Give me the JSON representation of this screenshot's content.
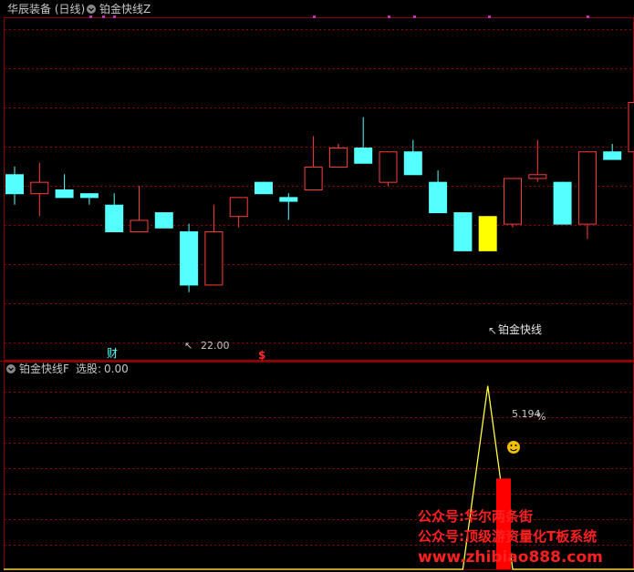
{
  "upper_panel": {
    "title": "华辰装备 (日线)",
    "indicator": "铂金快线Z",
    "low_annotation": "22.00",
    "signal_label": "铂金快线",
    "marker_cai": "财",
    "marker_dollar": "$"
  },
  "lower_panel": {
    "indicator": "铂金快线F",
    "select_label": "选股:",
    "select_value": "0.00",
    "percent_label": "5.194",
    "percent_sign": "%"
  },
  "watermark": {
    "line1": "公众号:华尔两条街",
    "line2": "公众号:顶级游资量化T板系统",
    "line3": "www.zhibiao888.com"
  },
  "colors": {
    "up": "#ff3c3c",
    "down": "#54ffff",
    "signal": "#ffff00",
    "grid": "#8b0000",
    "purple": "#c030c0"
  },
  "icons": {
    "dropdown": "chevron-down-circle-icon",
    "arrow": "arrow-up-left-icon",
    "smiley": "smiley-icon"
  },
  "chart_data": {
    "type": "candlestick",
    "price_range": [
      20.5,
      29.5
    ],
    "candles": [
      {
        "open": 25.4,
        "close": 24.9,
        "high": 25.6,
        "low": 24.6
      },
      {
        "open": 24.9,
        "close": 25.2,
        "high": 25.7,
        "low": 24.3
      },
      {
        "open": 25.0,
        "close": 24.8,
        "high": 25.4,
        "low": 24.8
      },
      {
        "open": 24.9,
        "close": 24.8,
        "high": 24.9,
        "low": 24.6
      },
      {
        "open": 24.6,
        "close": 23.9,
        "high": 24.9,
        "low": 23.9
      },
      {
        "open": 23.9,
        "close": 24.2,
        "high": 25.1,
        "low": 23.9
      },
      {
        "open": 24.4,
        "close": 24.0,
        "high": 24.4,
        "low": 24.0
      },
      {
        "open": 23.9,
        "close": 22.5,
        "high": 24.1,
        "low": 22.3
      },
      {
        "open": 22.5,
        "close": 23.9,
        "high": 24.6,
        "low": 22.5
      },
      {
        "open": 24.3,
        "close": 24.8,
        "high": 24.8,
        "low": 24.0
      },
      {
        "open": 25.2,
        "close": 24.9,
        "high": 25.2,
        "low": 24.9
      },
      {
        "open": 24.8,
        "close": 24.7,
        "high": 24.9,
        "low": 24.2
      },
      {
        "open": 25.0,
        "close": 25.6,
        "high": 26.4,
        "low": 25.0
      },
      {
        "open": 25.6,
        "close": 26.1,
        "high": 26.2,
        "low": 25.6
      },
      {
        "open": 26.1,
        "close": 25.7,
        "high": 26.9,
        "low": 25.7
      },
      {
        "open": 25.2,
        "close": 26.0,
        "high": 26.0,
        "low": 25.1
      },
      {
        "open": 26.0,
        "close": 25.4,
        "high": 26.3,
        "low": 25.4
      },
      {
        "open": 25.2,
        "close": 24.4,
        "high": 25.5,
        "low": 24.4
      },
      {
        "open": 24.4,
        "close": 23.4,
        "high": 24.4,
        "low": 23.4
      },
      {
        "open": 23.4,
        "close": 24.3,
        "high": 24.3,
        "low": 23.4
      },
      {
        "open": 24.1,
        "close": 25.3,
        "high": 25.3,
        "low": 24.0
      },
      {
        "open": 25.3,
        "close": 25.4,
        "high": 26.3,
        "low": 25.2
      },
      {
        "open": 25.2,
        "close": 24.1,
        "high": 25.2,
        "low": 24.1
      },
      {
        "open": 24.1,
        "close": 26.0,
        "high": 26.0,
        "low": 23.7
      },
      {
        "open": 26.0,
        "close": 25.8,
        "high": 26.2,
        "low": 25.8
      },
      {
        "open": 26.0,
        "close": 27.3,
        "high": 27.3,
        "low": 25.9
      }
    ],
    "signal_candle_index": 19,
    "lower_line": {
      "y_range": [
        0,
        1
      ],
      "x": [
        0,
        18,
        19,
        20,
        21,
        25
      ],
      "y": [
        0,
        0,
        0.95,
        0,
        0,
        0
      ]
    },
    "bar": {
      "index": 20,
      "value": 0.47
    }
  }
}
